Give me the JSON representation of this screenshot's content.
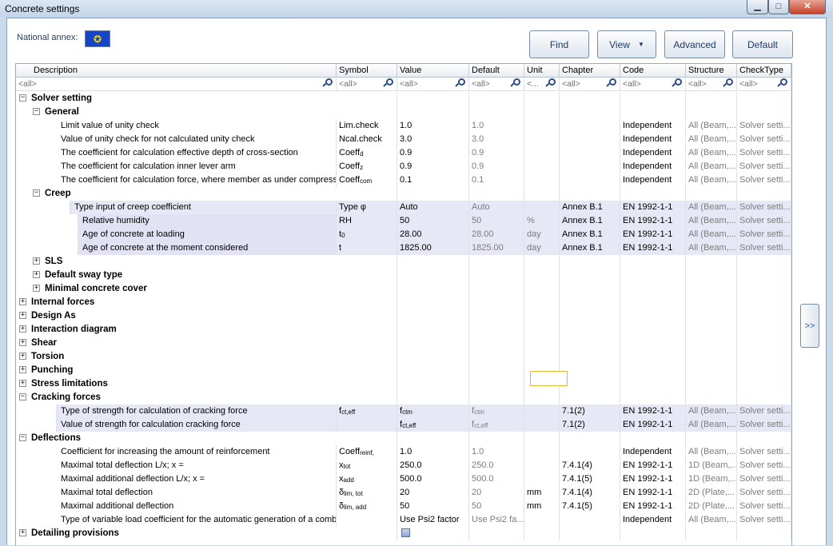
{
  "window": {
    "title": "Concrete settings",
    "min_label": "▁",
    "max_label": "□",
    "close_label": "✕"
  },
  "national_annex": {
    "label": "National annex:",
    "flag_icon": "eu-flag-icon",
    "flag_glyph": "✪"
  },
  "toolbar": {
    "find": "Find",
    "view": "View",
    "view_arrow": "▼",
    "advanced": "Advanced",
    "default": "Default"
  },
  "side_expand": ">>",
  "columns": [
    "Description",
    "Symbol",
    "Value",
    "Default",
    "Unit",
    "Chapter",
    "Code",
    "Structure",
    "CheckType"
  ],
  "filters": [
    "<all>",
    "<all>",
    "<all>",
    "<all>",
    "<...",
    "<all>",
    "<all>",
    "<all>",
    "<all>"
  ],
  "rows": [
    {
      "type": "group",
      "level": 0,
      "open": true,
      "label": "Solver setting"
    },
    {
      "type": "group",
      "level": 1,
      "open": true,
      "label": "General"
    },
    {
      "type": "item",
      "level": 2,
      "desc": "Limit value of unity check",
      "sym": "Lim.check",
      "val": "1.0",
      "def": "1.0",
      "unit": "",
      "chap": "",
      "code": "Independent",
      "str": "All (Beam,...",
      "chk": "Solver setti..."
    },
    {
      "type": "item",
      "level": 2,
      "desc": "Value of unity check for not calculated unity check",
      "sym": "Ncal.check",
      "val": "3.0",
      "def": "3.0",
      "unit": "",
      "chap": "",
      "code": "Independent",
      "str": "All (Beam,...",
      "chk": "Solver setti..."
    },
    {
      "type": "item",
      "level": 2,
      "desc": "The coefficient for calculation effective depth of cross-section",
      "sym": "Coeff",
      "symsub": "d",
      "val": "0.9",
      "def": "0.9",
      "unit": "",
      "chap": "",
      "code": "Independent",
      "str": "All (Beam,...",
      "chk": "Solver setti..."
    },
    {
      "type": "item",
      "level": 2,
      "desc": "The coefficient for calculation inner lever arm",
      "sym": "Coeff",
      "symsub": "z",
      "val": "0.9",
      "def": "0.9",
      "unit": "",
      "chap": "",
      "code": "Independent",
      "str": "All (Beam,...",
      "chk": "Solver setti..."
    },
    {
      "type": "item",
      "level": 2,
      "desc": "The coefficient for calculation force, where member as under compressi...",
      "sym": "Coeff",
      "symsub": "com",
      "val": "0.1",
      "def": "0.1",
      "unit": "",
      "chap": "",
      "code": "Independent",
      "str": "All (Beam,...",
      "chk": "Solver setti..."
    },
    {
      "type": "group",
      "level": 1,
      "open": true,
      "label": "Creep"
    },
    {
      "type": "item",
      "level": 3,
      "hl": true,
      "desc": "Type input of creep coefficient",
      "sym": "Type φ",
      "val": "Auto",
      "def": "Auto",
      "unit": "",
      "chap": "Annex B.1",
      "code": "EN 1992-1-1",
      "str": "All (Beam,...",
      "chk": "Solver setti..."
    },
    {
      "type": "item",
      "level": 4,
      "hl": true,
      "desc": "Relative humidity",
      "sym": "RH",
      "val": "50",
      "def": "50",
      "unit": "%",
      "chap": "Annex B.1",
      "code": "EN 1992-1-1",
      "str": "All (Beam,...",
      "chk": "Solver setti..."
    },
    {
      "type": "item",
      "level": 4,
      "hl": true,
      "desc": "Age of concrete at loading",
      "sym": "t",
      "symsub": "0",
      "val": "28.00",
      "def": "28.00",
      "unit": "day",
      "chap": "Annex B.1",
      "code": "EN 1992-1-1",
      "str": "All (Beam,...",
      "chk": "Solver setti..."
    },
    {
      "type": "item",
      "level": 4,
      "hl": true,
      "desc": "Age of concrete at the moment considered",
      "sym": "t",
      "val": "1825.00",
      "def": "1825.00",
      "unit": "day",
      "chap": "Annex B.1",
      "code": "EN 1992-1-1",
      "str": "All (Beam,...",
      "chk": "Solver setti..."
    },
    {
      "type": "group",
      "level": 1,
      "open": false,
      "label": "SLS"
    },
    {
      "type": "group",
      "level": 1,
      "open": false,
      "label": "Default sway type"
    },
    {
      "type": "group",
      "level": 1,
      "open": false,
      "label": "Minimal concrete cover"
    },
    {
      "type": "group",
      "level": 0,
      "open": false,
      "label": "Internal forces"
    },
    {
      "type": "group",
      "level": 0,
      "open": false,
      "label": "Design As"
    },
    {
      "type": "group",
      "level": 0,
      "open": false,
      "label": "Interaction diagram"
    },
    {
      "type": "group",
      "level": 0,
      "open": false,
      "label": "Shear"
    },
    {
      "type": "group",
      "level": 0,
      "open": false,
      "label": "Torsion"
    },
    {
      "type": "group",
      "level": 0,
      "open": false,
      "label": "Punching"
    },
    {
      "type": "group",
      "level": 0,
      "open": false,
      "label": "Stress limitations"
    },
    {
      "type": "group",
      "level": 0,
      "open": true,
      "label": "Cracking forces"
    },
    {
      "type": "item",
      "level": 2,
      "hl": true,
      "desc": "Type of strength for calculation of cracking force",
      "sym": "f",
      "symsub": "ct,eff",
      "val": "f",
      "valsub": "ctm",
      "def": "f",
      "defsub": "ctm",
      "unit": "",
      "chap": "7.1(2)",
      "code": "EN 1992-1-1",
      "str": "All (Beam,...",
      "chk": "Solver setti..."
    },
    {
      "type": "item",
      "level": 2,
      "hl": true,
      "desc": "Value of strength for calculation cracking force",
      "sym": "",
      "val": "f",
      "valsub": "ct,eff",
      "def": "f",
      "defsub": "ct,eff",
      "unit": "",
      "chap": "7.1(2)",
      "code": "EN 1992-1-1",
      "str": "All (Beam,...",
      "chk": "Solver setti..."
    },
    {
      "type": "group",
      "level": 0,
      "open": true,
      "label": "Deflections"
    },
    {
      "type": "item",
      "level": 2,
      "desc": "Coefficient for increasing the amount of reinforcement",
      "sym": "Coeff",
      "symsub": "reinf,",
      "val": "1.0",
      "def": "1.0",
      "unit": "",
      "chap": "",
      "code": "Independent",
      "str": "All (Beam,...",
      "chk": "Solver setti..."
    },
    {
      "type": "item",
      "level": 2,
      "desc": "Maximal total deflection L/x; x =",
      "sym": "x",
      "symsub": "tot",
      "val": "250.0",
      "def": "250.0",
      "unit": "",
      "chap": "7.4.1(4)",
      "code": "EN 1992-1-1",
      "str": "1D (Beam,...",
      "chk": "Solver setti..."
    },
    {
      "type": "item",
      "level": 2,
      "desc": "Maximal additional deflection L/x; x =",
      "sym": "x",
      "symsub": "add",
      "val": "500.0",
      "def": "500.0",
      "unit": "",
      "chap": "7.4.1(5)",
      "code": "EN 1992-1-1",
      "str": "1D (Beam,...",
      "chk": "Solver setti..."
    },
    {
      "type": "item",
      "level": 2,
      "desc": "Maximal total deflection",
      "sym": "δ",
      "symsub": "lim, tot",
      "val": "20",
      "def": "20",
      "unit": "mm",
      "chap": "7.4.1(4)",
      "code": "EN 1992-1-1",
      "str": "2D (Plate,...",
      "chk": "Solver setti..."
    },
    {
      "type": "item",
      "level": 2,
      "desc": "Maximal additional deflection",
      "sym": "δ",
      "symsub": "lim, add",
      "val": "50",
      "def": "50",
      "unit": "mm",
      "chap": "7.4.1(5)",
      "code": "EN 1992-1-1",
      "str": "2D (Plate,...",
      "chk": "Solver setti..."
    },
    {
      "type": "item",
      "level": 2,
      "desc": "Type of variable load coefficient for the automatic generation of a comb...",
      "sym": "",
      "val": "Use Psi2 factor",
      "def": "Use Psi2 fa...",
      "unit": "",
      "chap": "",
      "code": "Independent",
      "str": "All (Beam,...",
      "chk": "Solver setti..."
    },
    {
      "type": "group",
      "level": 0,
      "open": false,
      "label": "Detailing provisions",
      "checkbox": true
    }
  ]
}
